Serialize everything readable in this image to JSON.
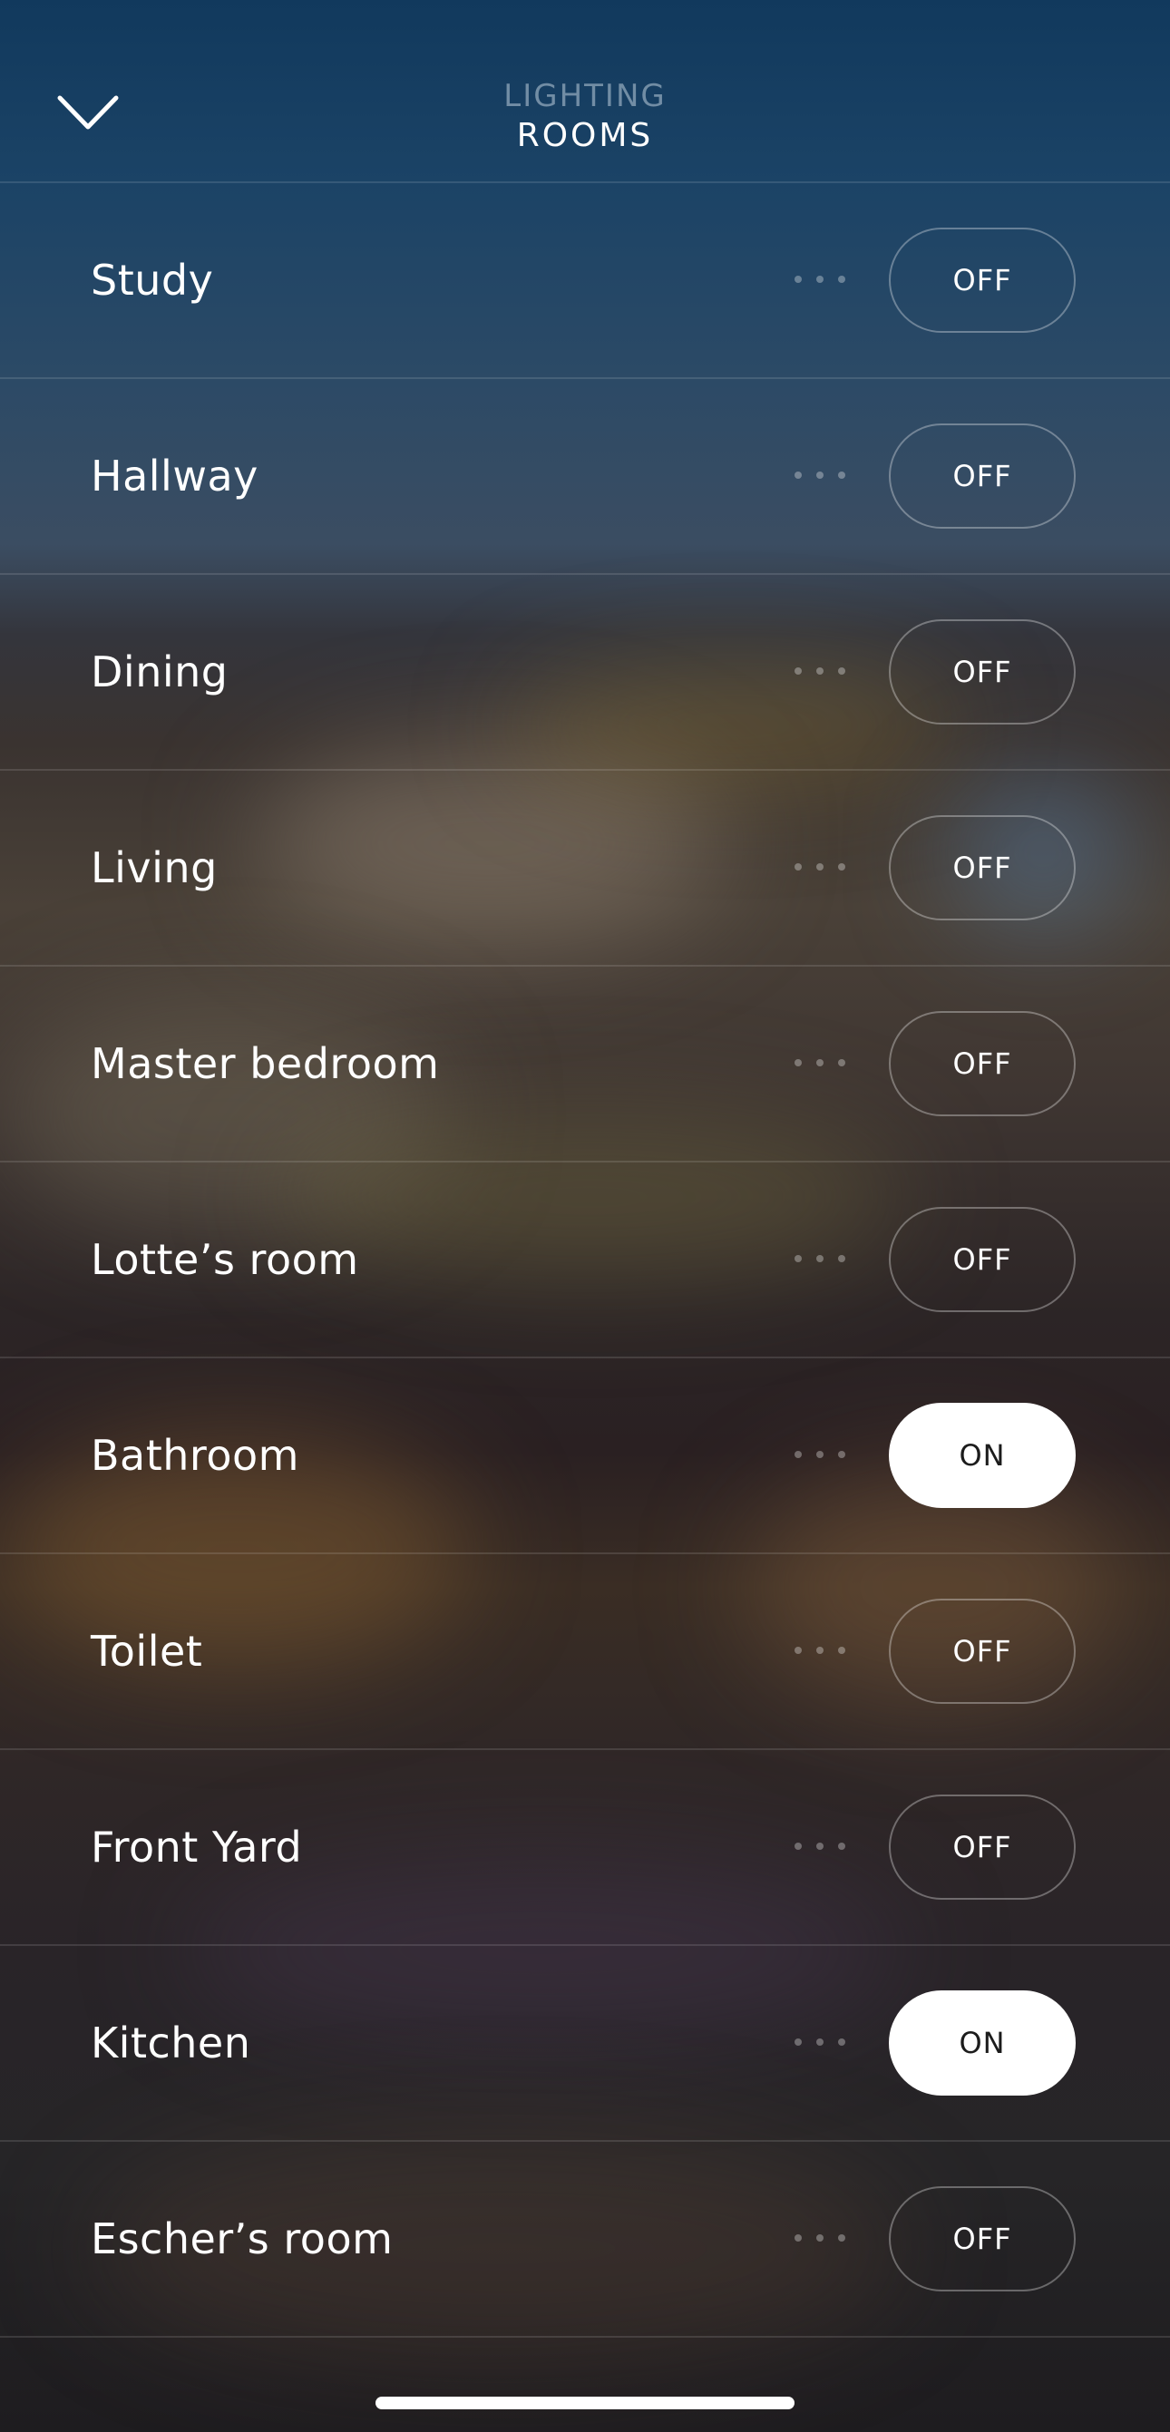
{
  "header": {
    "back_icon": "chevron-down-icon",
    "subtitle": "LIGHTING",
    "title": "ROOMS"
  },
  "rooms": [
    {
      "name": "Study",
      "state": "OFF"
    },
    {
      "name": "Hallway",
      "state": "OFF"
    },
    {
      "name": "Dining",
      "state": "OFF"
    },
    {
      "name": "Living",
      "state": "OFF"
    },
    {
      "name": "Master bedroom",
      "state": "OFF"
    },
    {
      "name": "Lotte’s room",
      "state": "OFF"
    },
    {
      "name": "Bathroom",
      "state": "ON"
    },
    {
      "name": "Toilet",
      "state": "OFF"
    },
    {
      "name": "Front Yard",
      "state": "OFF"
    },
    {
      "name": "Kitchen",
      "state": "ON"
    },
    {
      "name": "Escher’s room",
      "state": "OFF"
    }
  ],
  "row_more_icon": "more-horizontal-icon",
  "colors": {
    "toggle_on_bg": "#ffffff",
    "toggle_on_text": "#1c1c1c",
    "toggle_off_border": "rgba(255,255,255,0.32)",
    "header_subtitle": "rgba(190,205,220,0.55)"
  }
}
